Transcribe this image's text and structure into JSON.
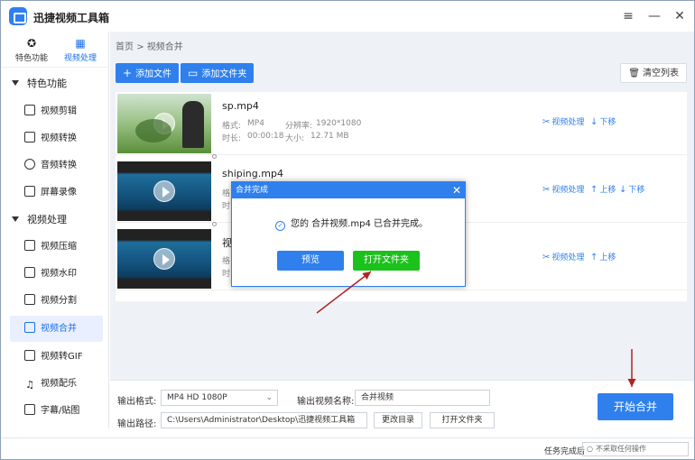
{
  "app": {
    "title": "迅捷视频工具箱"
  },
  "window_controls": {
    "menu": "≡",
    "minimize": "—",
    "close": "✕"
  },
  "sidebar": {
    "tabs": [
      {
        "label": "特色功能",
        "icon": "star-icon",
        "active": false
      },
      {
        "label": "视频处理",
        "icon": "film-icon",
        "active": true
      }
    ],
    "sections": [
      {
        "label": "特色功能",
        "items": [
          {
            "label": "视频剪辑",
            "icon": "scissors-icon"
          },
          {
            "label": "视频转换",
            "icon": "convert-icon"
          },
          {
            "label": "音频转换",
            "icon": "audio-icon"
          },
          {
            "label": "屏幕录像",
            "icon": "screen-record-icon"
          }
        ]
      },
      {
        "label": "视频处理",
        "items": [
          {
            "label": "视频压缩",
            "icon": "compress-icon"
          },
          {
            "label": "视频水印",
            "icon": "watermark-icon"
          },
          {
            "label": "视频分割",
            "icon": "split-icon"
          },
          {
            "label": "视频合并",
            "icon": "merge-icon",
            "active": true
          },
          {
            "label": "视频转GIF",
            "icon": "gif-icon"
          },
          {
            "label": "视频配乐",
            "icon": "music-icon"
          },
          {
            "label": "字幕/贴图",
            "icon": "subtitle-icon"
          }
        ]
      }
    ]
  },
  "breadcrumb": {
    "home": "首页",
    "sep": ">",
    "current": "视频合并"
  },
  "toolbar": {
    "add_file": "添加文件",
    "add_folder": "添加文件夹",
    "clear_list": "清空列表"
  },
  "files": [
    {
      "name": "sp.mp4",
      "format_label": "格式:",
      "format": "MP4",
      "resolution_label": "分辨率:",
      "resolution": "1920*1080",
      "duration_label": "时长:",
      "duration": "00:00:18",
      "size_label": "大小:",
      "size": "12.71 MB",
      "actions": [
        "视频处理",
        "下移"
      ]
    },
    {
      "name": "shiping.mp4",
      "format_label": "格",
      "duration_label": "时",
      "actions": [
        "视频处理",
        "上移",
        "下移"
      ]
    },
    {
      "name": "视",
      "format_label": "格",
      "duration_label": "时",
      "actions": [
        "视频处理",
        "上移"
      ]
    }
  ],
  "dialog": {
    "title": "合并完成",
    "close": "✕",
    "message": "您的 合并视频.mp4 已合并完成。",
    "preview_button": "预览",
    "open_folder_button": "打开文件夹"
  },
  "output": {
    "format_label": "输出格式:",
    "format_value": "MP4  HD 1080P",
    "name_label": "输出视频名称:",
    "name_value": "合并视频",
    "path_label": "输出路径:",
    "path_value": "C:\\Users\\Administrator\\Desktop\\迅捷视频工具箱",
    "change_dir_button": "更改目录",
    "open_folder_button": "打开文件夹",
    "start_button": "开始合并"
  },
  "statusbar": {
    "after_task_label": "任务完成后",
    "after_task_value": "不采取任何操作"
  },
  "colors": {
    "accent": "#2f80ed",
    "success_green": "#1bc21b",
    "annotation_red": "#b22222"
  }
}
